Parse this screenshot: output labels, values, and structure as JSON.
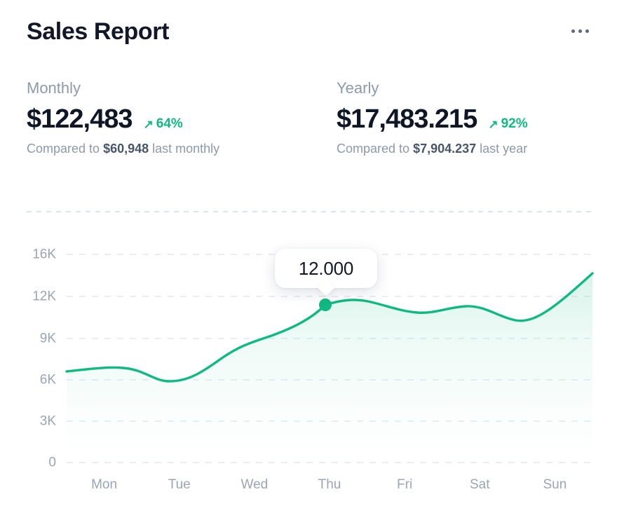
{
  "header": {
    "title": "Sales Report",
    "menu_icon": "ellipsis-horizontal-icon"
  },
  "stats": [
    {
      "label": "Monthly",
      "value": "$122,483",
      "delta": "64%",
      "delta_icon": "arrow-up-right-icon",
      "delta_color": "#10b981",
      "compare_prefix": "Compared to ",
      "compare_amount": "$60,948",
      "compare_suffix": " last monthly"
    },
    {
      "label": "Yearly",
      "value": "$17,483.215",
      "delta": "92%",
      "delta_icon": "arrow-up-right-icon",
      "delta_color": "#10b981",
      "compare_prefix": "Compared to ",
      "compare_amount": "$7,904.237",
      "compare_suffix": " last year"
    }
  ],
  "tooltip": {
    "value": "12.000"
  },
  "chart_data": {
    "type": "area",
    "title": "Sales Report",
    "xlabel": "",
    "ylabel": "",
    "grid": true,
    "legend": false,
    "line_color": "#10b981",
    "fill_color": "#10b981",
    "categories": [
      "Mon",
      "Tue",
      "Wed",
      "Thu",
      "Fri",
      "Sat",
      "Sun"
    ],
    "values": [
      6400,
      6000,
      8200,
      12000,
      11300,
      10600,
      13500
    ],
    "ytick_labels": [
      "16K",
      "12K",
      "9K",
      "6K",
      "3K",
      "0"
    ],
    "ytick_values": [
      16000,
      12000,
      9000,
      6000,
      3000,
      0
    ],
    "ylim": [
      0,
      16000
    ],
    "highlight": {
      "category": "Thu",
      "value": 12000,
      "label": "12.000"
    }
  }
}
